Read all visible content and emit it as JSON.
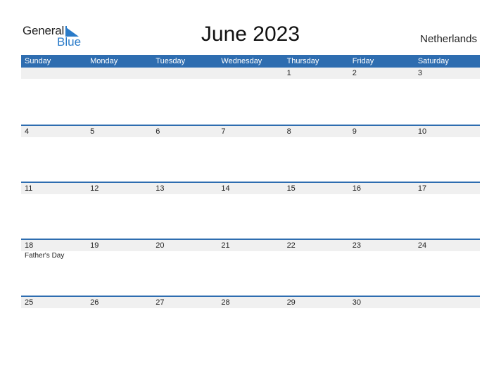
{
  "logo": {
    "line1": "General",
    "line2": "Blue"
  },
  "title": "June 2023",
  "country": "Netherlands",
  "weekdays": [
    "Sunday",
    "Monday",
    "Tuesday",
    "Wednesday",
    "Thursday",
    "Friday",
    "Saturday"
  ],
  "weeks": [
    {
      "days": [
        "",
        "",
        "",
        "",
        "1",
        "2",
        "3"
      ],
      "events": [
        "",
        "",
        "",
        "",
        "",
        "",
        ""
      ]
    },
    {
      "days": [
        "4",
        "5",
        "6",
        "7",
        "8",
        "9",
        "10"
      ],
      "events": [
        "",
        "",
        "",
        "",
        "",
        "",
        ""
      ]
    },
    {
      "days": [
        "11",
        "12",
        "13",
        "14",
        "15",
        "16",
        "17"
      ],
      "events": [
        "",
        "",
        "",
        "",
        "",
        "",
        ""
      ]
    },
    {
      "days": [
        "18",
        "19",
        "20",
        "21",
        "22",
        "23",
        "24"
      ],
      "events": [
        "Father's Day",
        "",
        "",
        "",
        "",
        "",
        ""
      ]
    },
    {
      "days": [
        "25",
        "26",
        "27",
        "28",
        "29",
        "30",
        ""
      ],
      "events": [
        "",
        "",
        "",
        "",
        "",
        "",
        ""
      ]
    }
  ],
  "colors": {
    "header": "#2e6db0",
    "brand_blue": "#2a7bc9",
    "day_row": "#f0f0f0"
  }
}
